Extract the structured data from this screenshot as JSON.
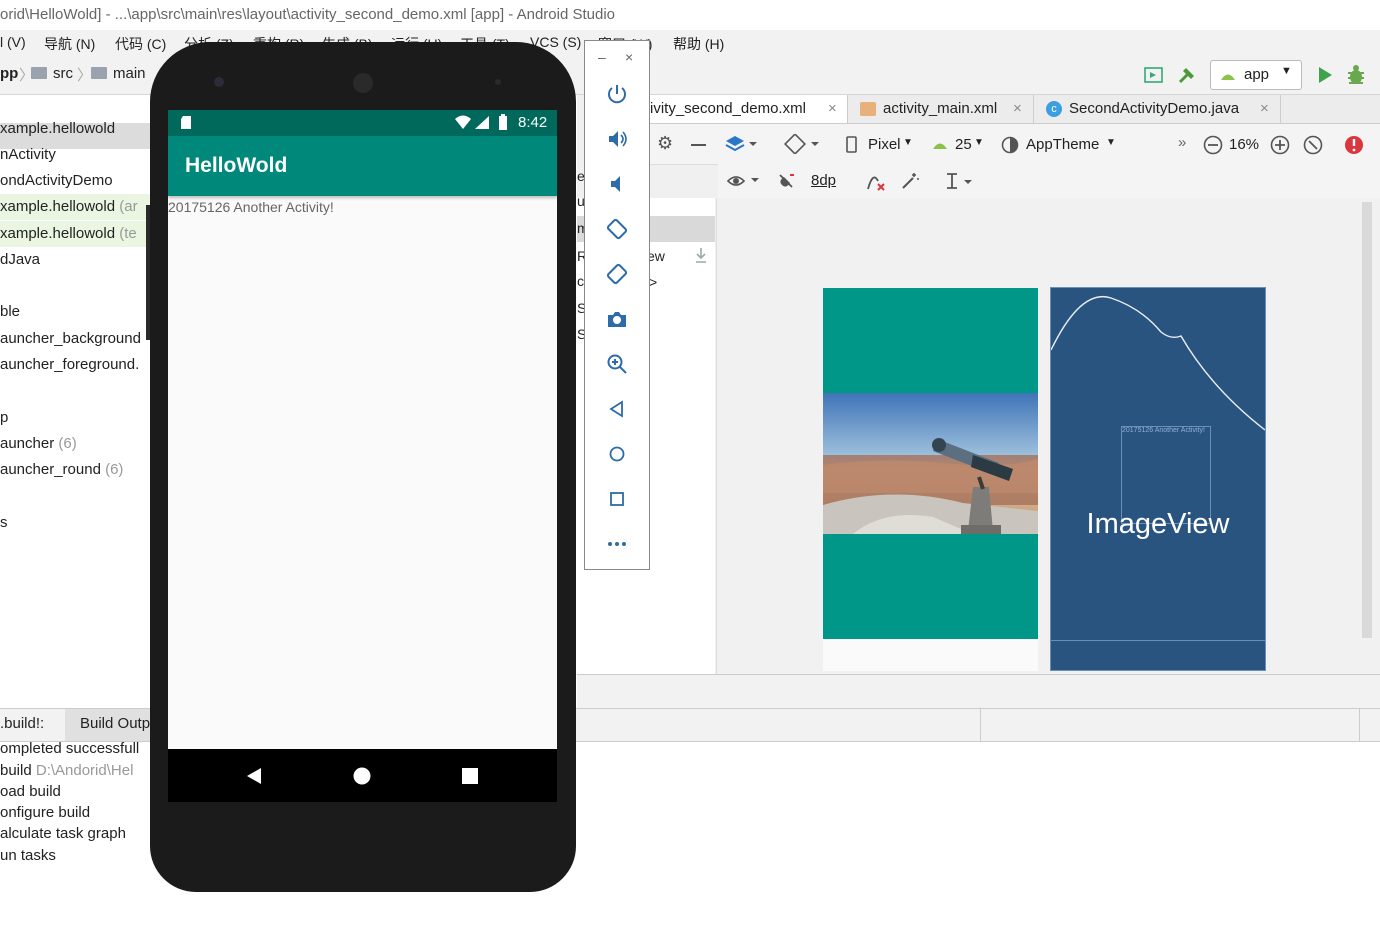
{
  "window": {
    "title": "orid\\HelloWold] - ...\\app\\src\\main\\res\\layout\\activity_second_demo.xml [app] - Android Studio"
  },
  "menu": {
    "items": [
      "l (V)",
      "导航 (N)",
      "代码 (C)",
      "分析 (Z)",
      "重构 (R)",
      "生成 (B)",
      "运行 (U)",
      "工具 (T)",
      "VCS (S)",
      "窗口 (W)",
      "帮助 (H)"
    ]
  },
  "nav": {
    "crumbs": [
      "pp",
      "src",
      "main"
    ],
    "run_config": "app"
  },
  "project_tree": {
    "rows": [
      {
        "text": "xample.hellowold",
        "suffix": "",
        "highlight": false
      },
      {
        "text": "nActivity",
        "suffix": "",
        "highlight": false
      },
      {
        "text": "ondActivityDemo",
        "suffix": "",
        "highlight": false
      },
      {
        "text": "xample.hellowold",
        "suffix": " (ar",
        "highlight": true
      },
      {
        "text": "xample.hellowold",
        "suffix": " (te",
        "highlight": true
      },
      {
        "text": "dJava",
        "suffix": "",
        "highlight": false
      },
      {
        "text": "ble",
        "suffix": "",
        "highlight": false
      },
      {
        "text": "auncher_background",
        "suffix": "",
        "highlight": false
      },
      {
        "text": "auncher_foreground.",
        "suffix": "",
        "highlight": false
      },
      {
        "text": "p",
        "suffix": "",
        "highlight": false
      },
      {
        "text": "auncher",
        "suffix": " (6)",
        "highlight": false
      },
      {
        "text": "auncher_round",
        "suffix": " (6)",
        "highlight": false
      },
      {
        "text": "s",
        "suffix": "",
        "highlight": false
      }
    ]
  },
  "editor_tabs": [
    {
      "label": "ivity_second_demo.xml",
      "active": true
    },
    {
      "label": "activity_main.xml",
      "active": false
    },
    {
      "label": "SecondActivityDemo.java",
      "active": false
    }
  ],
  "design_toolbar": {
    "device": "Pixel",
    "api": "25",
    "theme": "AppTheme",
    "zoom": "16%",
    "margin": "8dp"
  },
  "palette_fragments": [
    "e",
    "u",
    "m",
    "Re",
    "ct",
    "Sc",
    "Sv",
    "ew",
    ">"
  ],
  "build": {
    "tabs": [
      ".build!:",
      "Build Outp"
    ],
    "lines": [
      {
        "text": "ompleted successfull",
        "dim": ""
      },
      {
        "text": "build ",
        "dim": "D:\\Andorid\\Hel"
      },
      {
        "text": "oad build",
        "dim": ""
      },
      {
        "text": "onfigure build",
        "dim": ""
      },
      {
        "text": "alculate task graph",
        "dim": ""
      },
      {
        "text": "un tasks",
        "dim": ""
      }
    ]
  },
  "emulator": {
    "status_time": "8:42",
    "app_title": "HelloWold",
    "content_text": "20175126 Another Activity!"
  },
  "blueprint": {
    "label": "ImageView",
    "small_text": "20175126 Another Activity!"
  },
  "colors": {
    "primary": "#00897b",
    "primary_dark": "#00695c",
    "preview_teal": "#009688",
    "blueprint": "#2a5480"
  }
}
